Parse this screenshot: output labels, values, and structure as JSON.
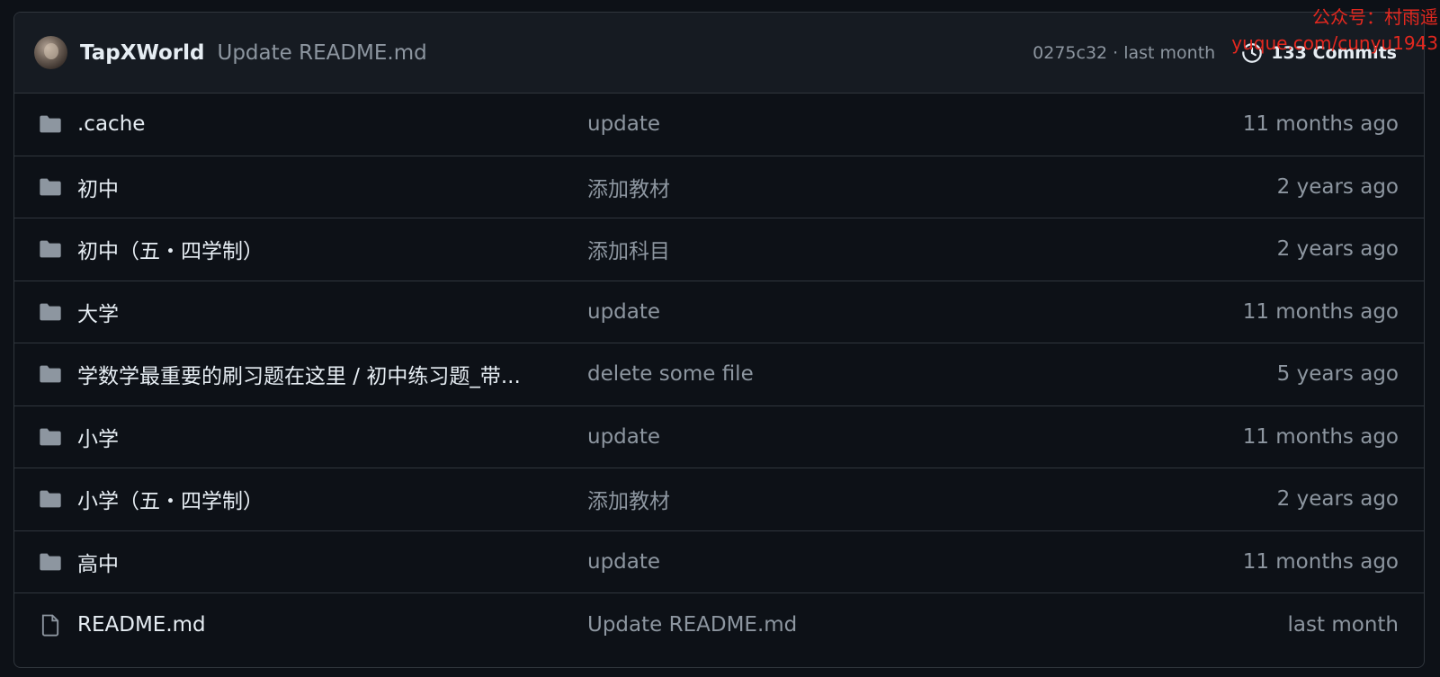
{
  "commit": {
    "author": "TapXWorld",
    "message": "Update README.md",
    "meta": "0275c32 · last month",
    "commits_count": "133 Commits"
  },
  "files": [
    {
      "name": ".cache",
      "type": "folder",
      "message": "update",
      "time": "11 months ago"
    },
    {
      "name": "初中",
      "type": "folder",
      "message": "添加教材",
      "time": "2 years ago"
    },
    {
      "name": "初中（五・四学制）",
      "type": "folder",
      "message": "添加科目",
      "time": "2 years ago"
    },
    {
      "name": "大学",
      "type": "folder",
      "message": "update",
      "time": "11 months ago"
    },
    {
      "name": "学数学最重要的刷习题在这里 / 初中练习题_带...",
      "type": "folder",
      "message": "delete some file",
      "time": "5 years ago"
    },
    {
      "name": "小学",
      "type": "folder",
      "message": "update",
      "time": "11 months ago"
    },
    {
      "name": "小学（五・四学制）",
      "type": "folder",
      "message": "添加教材",
      "time": "2 years ago"
    },
    {
      "name": "高中",
      "type": "folder",
      "message": "update",
      "time": "11 months ago"
    },
    {
      "name": "README.md",
      "type": "file",
      "message": "Update README.md",
      "time": "last month"
    }
  ],
  "watermark": {
    "line1": "公众号：村雨遥",
    "line2": "yuque.com/cunyu1943"
  },
  "colors": {
    "background": "#0d1117",
    "header_bg": "#161b22",
    "border": "#30363d",
    "text": "#e6edf3",
    "muted": "#8d96a0",
    "icon": "#8d96a0",
    "watermark": "#e3281f"
  },
  "icons": {
    "folder": "folder-icon",
    "file": "file-icon",
    "history": "history-icon"
  }
}
